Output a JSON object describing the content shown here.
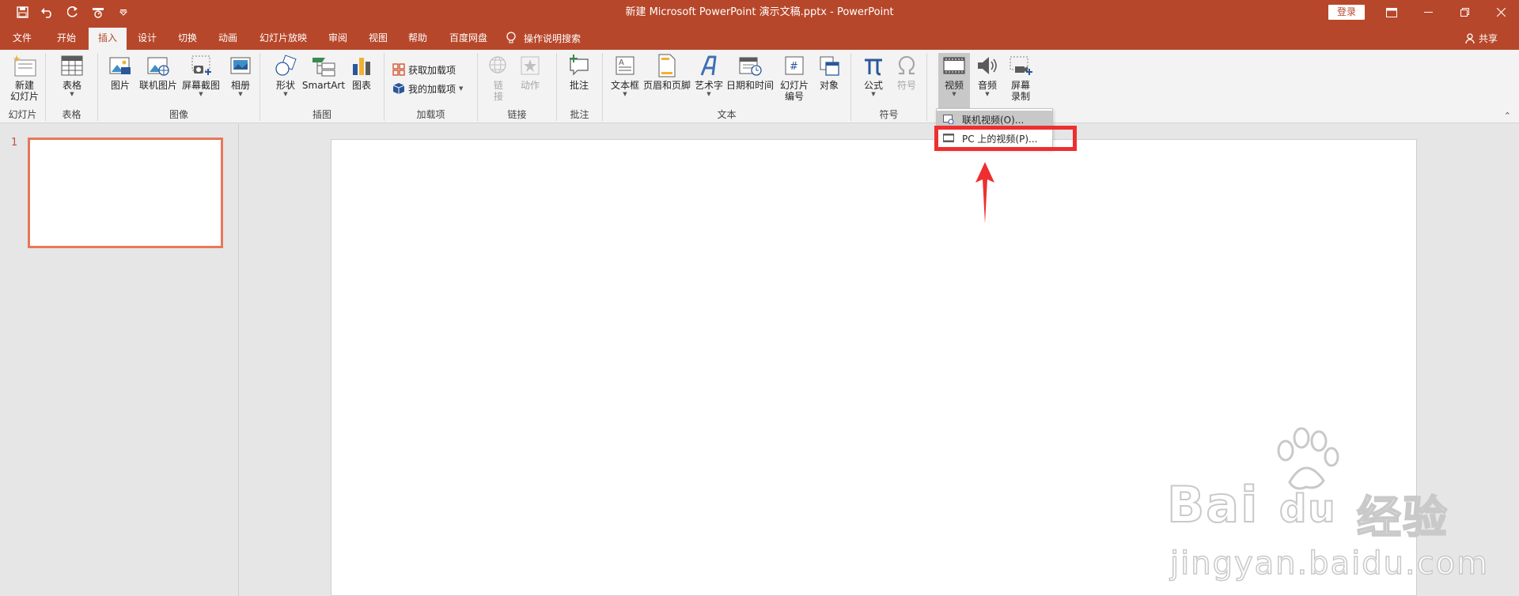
{
  "window": {
    "title": "新建 Microsoft PowerPoint 演示文稿.pptx  -  PowerPoint",
    "login_label": "登录"
  },
  "tabs": [
    {
      "label": "文件",
      "active": false
    },
    {
      "label": "开始",
      "active": false
    },
    {
      "label": "插入",
      "active": true
    },
    {
      "label": "设计",
      "active": false
    },
    {
      "label": "切换",
      "active": false
    },
    {
      "label": "动画",
      "active": false
    },
    {
      "label": "幻灯片放映",
      "active": false
    },
    {
      "label": "审阅",
      "active": false
    },
    {
      "label": "视图",
      "active": false
    },
    {
      "label": "帮助",
      "active": false
    },
    {
      "label": "百度网盘",
      "active": false
    }
  ],
  "tell_me": "操作说明搜索",
  "share_label": "共享",
  "ribbon": {
    "groups": {
      "slides": "幻灯片",
      "tables": "表格",
      "images": "图像",
      "illustrations": "插图",
      "addins": "加载项",
      "links": "链接",
      "comments": "批注",
      "text": "文本",
      "symbols": "符号"
    },
    "buttons": {
      "new_slide_1": "新建",
      "new_slide_2": "幻灯片",
      "table": "表格",
      "picture": "图片",
      "online_picture": "联机图片",
      "screenshot": "屏幕截图",
      "album": "相册",
      "shapes": "形状",
      "smartart": "SmartArt",
      "chart": "图表",
      "get_addins": "获取加载项",
      "my_addins": "我的加载项",
      "link_1": "链",
      "link_2": "接",
      "action": "动作",
      "comment": "批注",
      "textbox": "文本框",
      "header_footer": "页眉和页脚",
      "wordart": "艺术字",
      "datetime": "日期和时间",
      "slide_number_1": "幻灯片",
      "slide_number_2": "编号",
      "object": "对象",
      "equation": "公式",
      "symbol": "符号",
      "video": "视频",
      "audio": "音频",
      "screen_record_1": "屏幕",
      "screen_record_2": "录制"
    }
  },
  "video_menu": {
    "items": [
      "联机视频(O)...",
      "PC 上的视频(P)..."
    ]
  },
  "slides": {
    "thumbnail_number": "1"
  },
  "watermark": {
    "brand": "Bai",
    "brand2": "du",
    "cn": "经验",
    "url": "jingyan.baidu.com"
  },
  "colors": {
    "accent": "#b7472a",
    "highlight": "#ee2f2f"
  }
}
